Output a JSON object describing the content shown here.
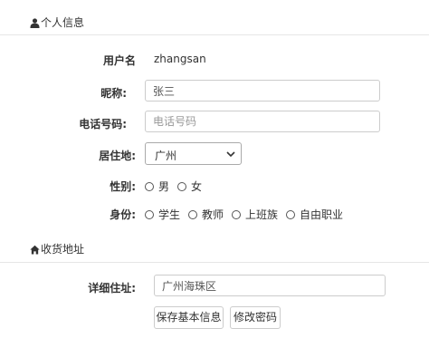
{
  "personal_section": {
    "title": "个人信息",
    "icon": "user-icon"
  },
  "username": {
    "label": "用户名",
    "value": "zhangsan"
  },
  "nickname": {
    "label": "昵称:",
    "value": "张三"
  },
  "phone": {
    "label": "电话号码:",
    "placeholder": "电话号码"
  },
  "residence": {
    "label": "居住地:",
    "selected": "广州",
    "icon": "chevron-down-icon"
  },
  "gender": {
    "label": "性别:",
    "options": [
      "男",
      "女"
    ]
  },
  "identity": {
    "label": "身份:",
    "options": [
      "学生",
      "教师",
      "上班族",
      "自由职业"
    ]
  },
  "address_section": {
    "title": "收货地址",
    "icon": "home-icon"
  },
  "address": {
    "label": "详细住址:",
    "value": "广州海珠区"
  },
  "buttons": {
    "save": "保存基本信息",
    "change_password": "修改密码"
  }
}
